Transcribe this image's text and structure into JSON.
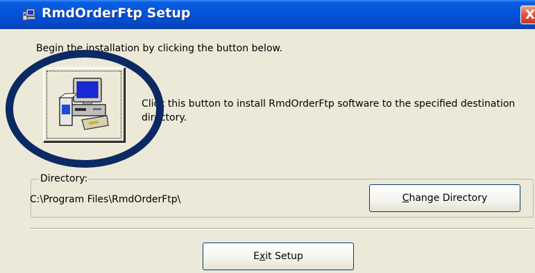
{
  "window": {
    "title": "RmdOrderFtp Setup",
    "close_label": "X"
  },
  "instructions": "Begin the installation by clicking the button below.",
  "install": {
    "description_line1": "Click this button to install RmdOrderFtp software to the specified destination",
    "description_line2": "directory."
  },
  "directory": {
    "group_label": "Directory:",
    "path": "C:\\Program Files\\RmdOrderFtp\\",
    "change_button_label": "Change Directory",
    "change_button_accel": "C",
    "change_button_rest": "hange Directory"
  },
  "exit": {
    "label": "Exit Setup",
    "prefix": "E",
    "accel": "x",
    "rest": "it Setup"
  },
  "colors": {
    "titlebar": "#0552dd",
    "window_bg": "#ece9d8",
    "annotation_circle": "#0b2a63",
    "close_button": "#e0573a"
  },
  "icons": {
    "title": "setup-computer-icon",
    "install": "computer-install-icon"
  }
}
